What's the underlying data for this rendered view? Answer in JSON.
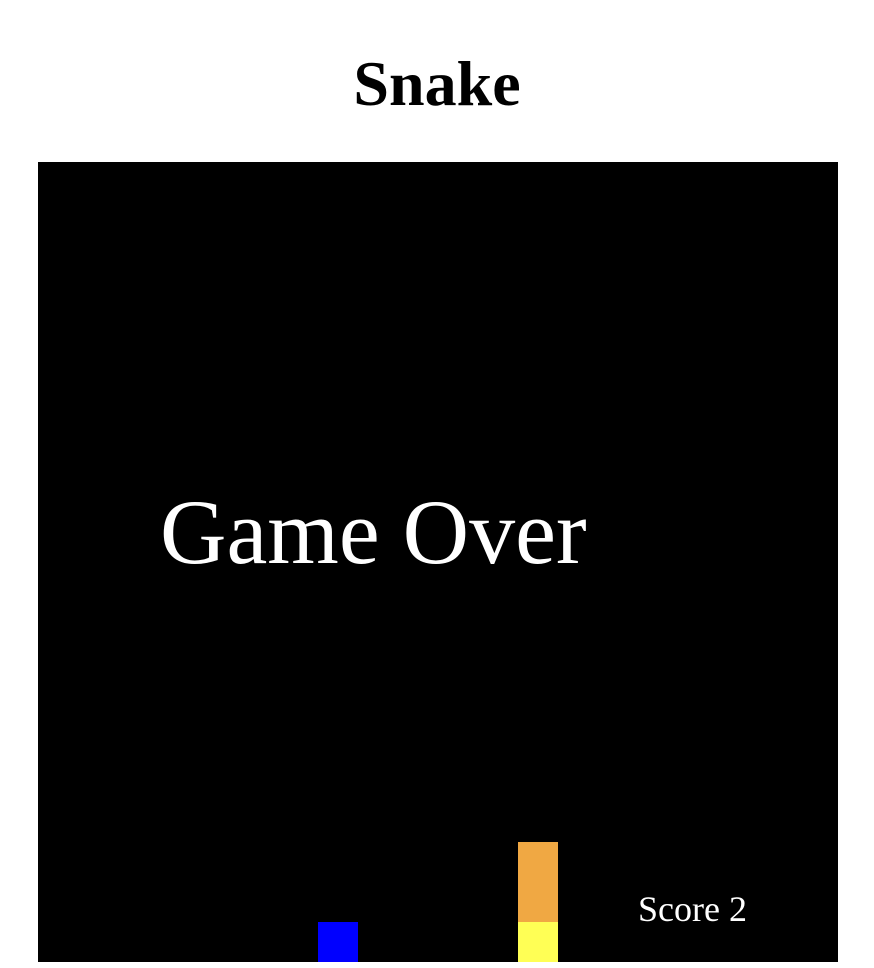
{
  "page": {
    "title": "Snake"
  },
  "game": {
    "status_text": "Game Over",
    "score_label": "Score",
    "score_value": "2",
    "colors": {
      "board": "#000000",
      "food": "#0000ff",
      "snake_body": "#f0a843",
      "snake_head": "#ffff55",
      "text": "#ffffff"
    },
    "food_icon": "food-square",
    "snake_length": 2
  }
}
